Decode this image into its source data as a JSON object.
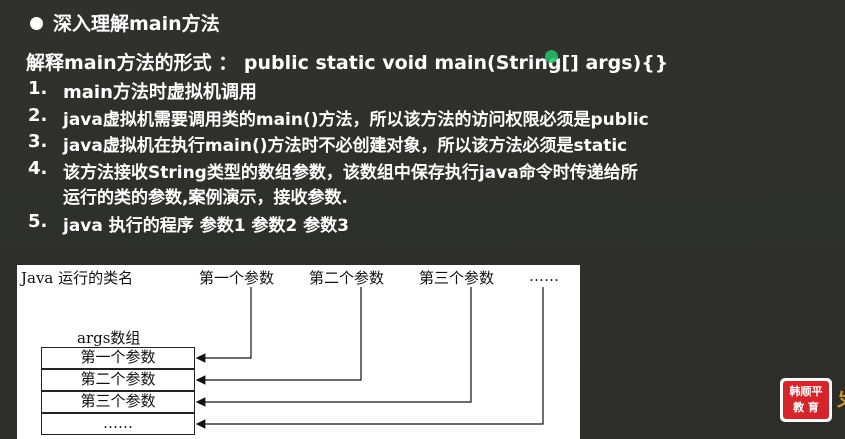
{
  "heading": "深入理解main方法",
  "subheading": "解释main方法的形式 ： public static void main(String[] args){}",
  "items": [
    {
      "num": "1.",
      "text": "main方法时虚拟机调用"
    },
    {
      "num": "2.",
      "text": "java虚拟机需要调用类的main()方法，所以该方法的访问权限必须是public"
    },
    {
      "num": "3.",
      "text": "java虚拟机在执行main()方法时不必创建对象，所以该方法必须是static"
    },
    {
      "num": "4.",
      "text": "该方法接收String类型的数组参数，该数组中保存执行java命令时传递给所",
      "cont": "运行的类的参数,案例演示，接收参数."
    },
    {
      "num": "5.",
      "text": "java  执行的程序 参数1 参数2 参数3"
    }
  ],
  "diagram": {
    "command": "Java 运行的类名",
    "params": [
      "第一个参数",
      "第二个参数",
      "第三个参数",
      "……"
    ],
    "array_title": "args数组",
    "cells": [
      "第一个参数",
      "第二个参数",
      "第三个参数",
      "……"
    ]
  },
  "logo": {
    "line1": "韩顺平",
    "line2": "教 育"
  },
  "edge_char": "ㄆ"
}
